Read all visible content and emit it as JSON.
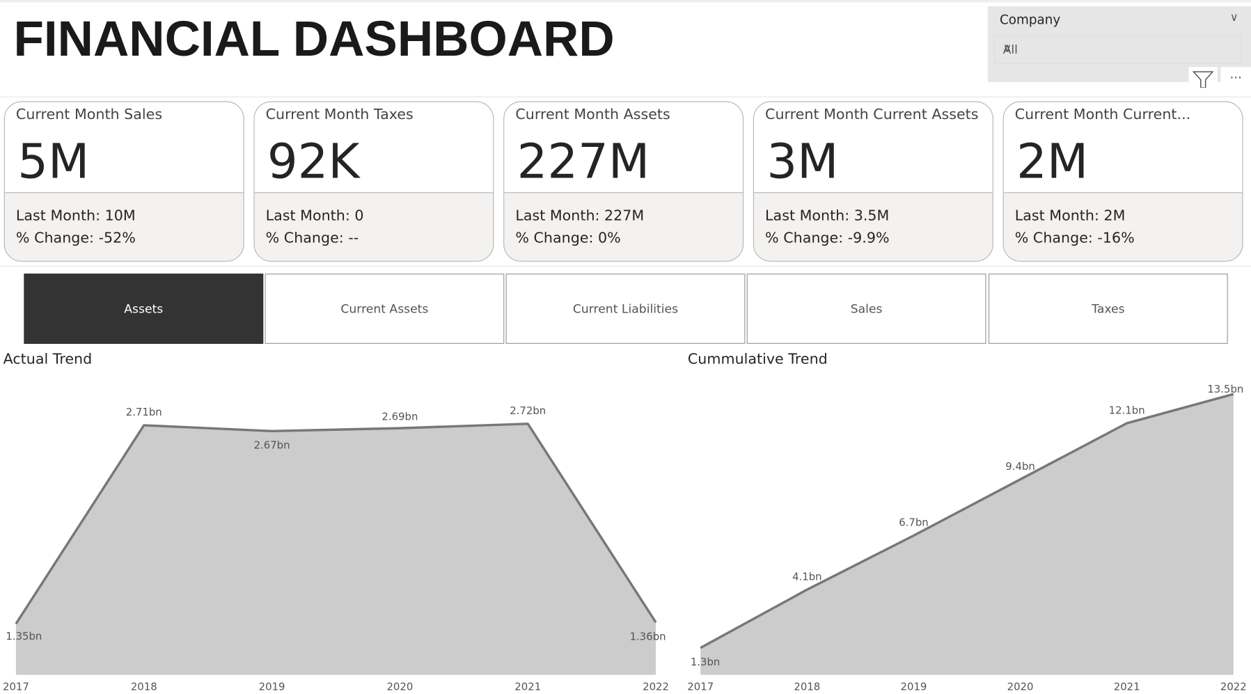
{
  "header": {
    "title": "FINANCIAL DASHBOARD"
  },
  "slicer": {
    "label": "Company",
    "value": "All",
    "icons": [
      "chevron-down-icon",
      "filter-icon",
      "more-options-icon"
    ],
    "more_label": "..."
  },
  "cards": [
    {
      "title": "Current Month Sales",
      "value": "5M",
      "last_month": "Last Month: 10M",
      "change": "% Change: -52%"
    },
    {
      "title": "Current Month Taxes",
      "value": "92K",
      "last_month": "Last Month: 0",
      "change": "% Change: --"
    },
    {
      "title": "Current Month Assets",
      "value": "227M",
      "last_month": "Last Month: 227M",
      "change": "% Change: 0%"
    },
    {
      "title": "Current Month Current Assets",
      "value": "3M",
      "last_month": "Last Month: 3.5M",
      "change": "% Change: -9.9%"
    },
    {
      "title": "Current Month Current...",
      "value": "2M",
      "last_month": "Last Month: 2M",
      "change": "% Change: -16%"
    }
  ],
  "tabs": [
    {
      "label": "Assets",
      "active": true
    },
    {
      "label": "Current Assets"
    },
    {
      "label": "Current Liabilities"
    },
    {
      "label": "Sales"
    },
    {
      "label": "Taxes"
    }
  ],
  "colors": {
    "area": "#cccccc",
    "line": "#777777",
    "active_tab": "#333333"
  },
  "chart_data": [
    {
      "type": "area",
      "title": "Actual Trend",
      "categories": [
        "2017",
        "2018",
        "2019",
        "2020",
        "2021",
        "2022"
      ],
      "values": [
        1.35,
        2.71,
        2.67,
        2.69,
        2.72,
        1.36
      ],
      "labels": [
        "1.35bn",
        "2.71bn",
        "2.67bn",
        "2.69bn",
        "2.72bn",
        "1.36bn"
      ],
      "ylim": [
        1,
        3
      ],
      "grid": false
    },
    {
      "type": "area",
      "title": "Cummulative Trend",
      "categories": [
        "2017",
        "2018",
        "2019",
        "2020",
        "2021",
        "2022"
      ],
      "values": [
        1.3,
        4.1,
        6.7,
        9.4,
        12.1,
        13.5
      ],
      "labels": [
        "1.3bn",
        "4.1bn",
        "6.7bn",
        "9.4bn",
        "12.1bn",
        "13.5bn"
      ],
      "ylim": [
        0,
        14
      ],
      "grid": false
    }
  ]
}
